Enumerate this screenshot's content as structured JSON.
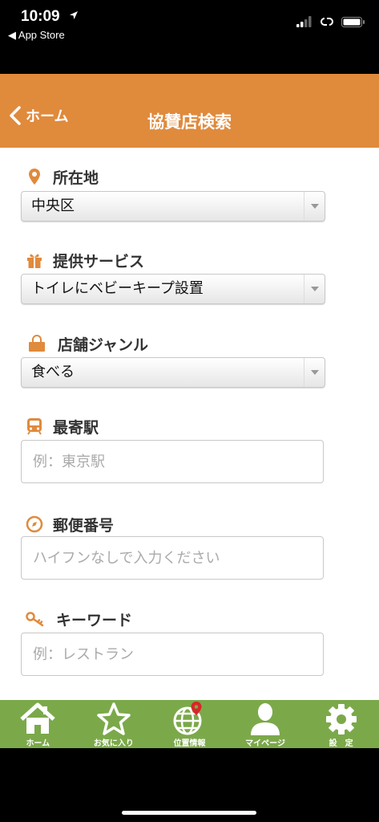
{
  "status_bar": {
    "time": "10:09",
    "back_app": "◀ App Store"
  },
  "nav": {
    "back_label": "ホーム",
    "title": "協賛店検索"
  },
  "fields": {
    "location": {
      "label": "所在地",
      "value": "中央区"
    },
    "service": {
      "label": "提供サービス",
      "value": "トイレにベビーキープ設置"
    },
    "genre": {
      "label": "店舗ジャンル",
      "value": "食べる"
    },
    "station": {
      "label": "最寄駅",
      "placeholder": "例：東京駅"
    },
    "postal": {
      "label": "郵便番号",
      "placeholder": "ハイフンなしで入力ください"
    },
    "keyword": {
      "label": "キーワード",
      "placeholder": "例：レストラン"
    }
  },
  "tabs": [
    {
      "label": "ホーム",
      "icon": "home-icon"
    },
    {
      "label": "お気に入り",
      "icon": "star-icon"
    },
    {
      "label": "位置情報",
      "icon": "globe-pin-icon"
    },
    {
      "label": "マイページ",
      "icon": "person-icon"
    },
    {
      "label": "設　定",
      "icon": "gear-icon"
    }
  ],
  "colors": {
    "header": "#E08A3C",
    "icon_accent": "#E08A3C",
    "tab_bar": "#7BA94A"
  }
}
